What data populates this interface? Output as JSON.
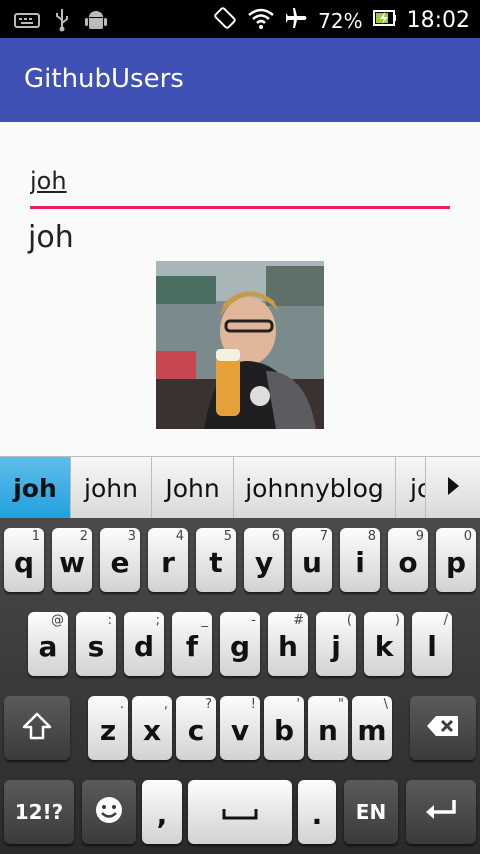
{
  "status": {
    "battery": "72%",
    "time": "18:02",
    "icons": [
      "keyboard-icon",
      "usb-icon",
      "android-icon",
      "rotate-icon",
      "wifi-icon",
      "airplane-icon",
      "battery-charging-icon"
    ]
  },
  "app": {
    "title": "GithubUsers",
    "accent": "#3f51b5",
    "input_accent": "#e91e63"
  },
  "search": {
    "value": "joh"
  },
  "result": {
    "login": "joh"
  },
  "suggestions": [
    "joh",
    "john",
    "John",
    "johnnyblog",
    "jo"
  ],
  "keyboard": {
    "row1": [
      [
        "q",
        "1"
      ],
      [
        "w",
        "2"
      ],
      [
        "e",
        "3"
      ],
      [
        "r",
        "4"
      ],
      [
        "t",
        "5"
      ],
      [
        "y",
        "6"
      ],
      [
        "u",
        "7"
      ],
      [
        "i",
        "8"
      ],
      [
        "o",
        "9"
      ],
      [
        "p",
        "0"
      ]
    ],
    "row2": [
      [
        "a",
        "@"
      ],
      [
        "s",
        ":"
      ],
      [
        "d",
        ";"
      ],
      [
        "f",
        "_"
      ],
      [
        "g",
        "-"
      ],
      [
        "h",
        "#"
      ],
      [
        "j",
        "("
      ],
      [
        "k",
        ")"
      ],
      [
        "l",
        "/"
      ]
    ],
    "row3": [
      [
        "z",
        "."
      ],
      [
        "x",
        ","
      ],
      [
        "c",
        "?"
      ],
      [
        "v",
        "!"
      ],
      [
        "b",
        "'"
      ],
      [
        "n",
        "\""
      ],
      [
        "m",
        "\\"
      ]
    ],
    "symbols_label": "12!?",
    "comma": ",",
    "period": ".",
    "lang_label": "EN"
  }
}
